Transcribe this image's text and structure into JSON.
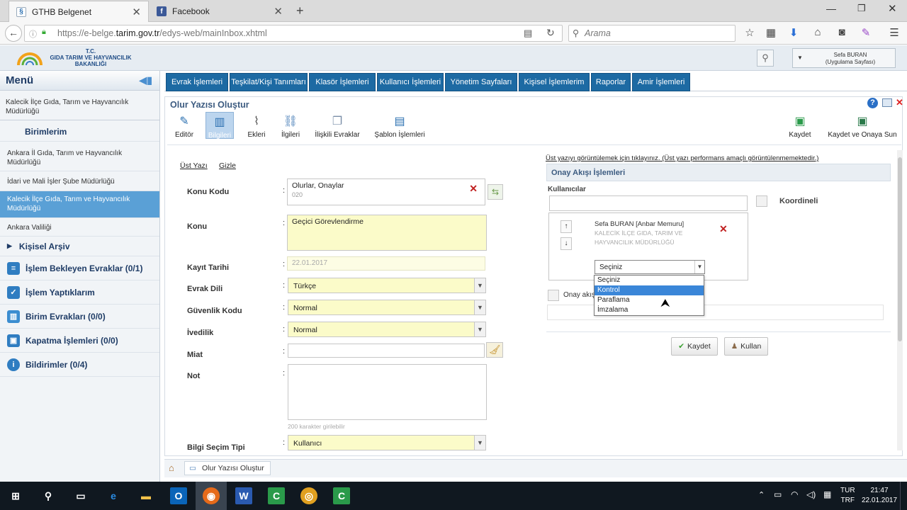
{
  "browser": {
    "tabs": [
      {
        "title": "GTHB Belgenet",
        "active": true
      },
      {
        "title": "Facebook",
        "active": false
      }
    ],
    "url_prefix": "https://e-belge.",
    "url_domain": "tarim.gov.tr",
    "url_suffix": "/edys-web/mainInbox.xhtml",
    "search_placeholder": "Arama"
  },
  "header": {
    "logo_line1": "T.C.",
    "logo_line2": "GIDA TARIM VE HAYVANCILIK",
    "logo_line3": "BAKANLIĞI",
    "user_name": "Sefa BURAN",
    "user_sub": "(Uygulama Sayfası)"
  },
  "sidebar": {
    "title": "Menü",
    "org": "Kalecik İlçe Gıda, Tarım ve Hayvancılık Müdürlüğü",
    "birimlerim": "Birimlerim",
    "units": [
      {
        "label": "Ankara İl Gıda, Tarım ve Hayvancılık Müdürlüğü",
        "selected": false
      },
      {
        "label": "İdari ve Mali İşler Şube Müdürlüğü",
        "selected": false
      },
      {
        "label": "Kalecik İlçe Gıda, Tarım ve Hayvancılık Müdürlüğü",
        "selected": true
      },
      {
        "label": "Ankara Valiliği",
        "selected": false
      }
    ],
    "kisisel_arsiv": "Kişisel Arşiv",
    "items": [
      {
        "label": "İşlem Bekleyen Evraklar (0/1)",
        "icon": "document-wait-icon",
        "color": "#2f7dc1"
      },
      {
        "label": "İşlem Yaptıklarım",
        "icon": "document-done-icon",
        "color": "#2f7dc1"
      },
      {
        "label": "Birim Evrakları (0/0)",
        "icon": "unit-docs-icon",
        "color": "#3b8dd0"
      },
      {
        "label": "Kapatma İşlemleri (0/0)",
        "icon": "close-ops-icon",
        "color": "#2f7dc1"
      },
      {
        "label": "Bildirimler (0/4)",
        "icon": "info-icon",
        "color": "#2f7dc1"
      }
    ]
  },
  "topmenu": [
    "Evrak İşlemleri",
    "Teşkilat/Kişi Tanımları",
    "Klasör İşlemleri",
    "Kullanıcı İşlemleri",
    "Yönetim Sayfaları",
    "Kişisel İşlemlerim",
    "Raporlar",
    "Amir İşlemleri"
  ],
  "form": {
    "title": "Olur Yazısı Oluştur",
    "toolbar": [
      "Editör",
      "Bilgileri",
      "Ekleri",
      "İlgileri",
      "İlişkili Evraklar",
      "Şablon İşlemleri"
    ],
    "save": "Kaydet",
    "save_submit": "Kaydet ve Onaya Sun",
    "ust_yazi": "Üst Yazı",
    "gizle": "Gizle",
    "konu_kodu_label": "Konu Kodu",
    "konu_kodu_value": "Olurlar, Onaylar",
    "konu_kodu_code": "020",
    "konu_label": "Konu",
    "konu_value": "Geçici Görevlendirme",
    "kayit_tarihi_label": "Kayıt Tarihi",
    "kayit_tarihi_value": "22.01.2017",
    "evrak_dili_label": "Evrak Dili",
    "evrak_dili_value": "Türkçe",
    "guvenlik_label": "Güvenlik Kodu",
    "guvenlik_value": "Normal",
    "ivedilik_label": "İvedilik",
    "ivedilik_value": "Normal",
    "miat_label": "Miat",
    "not_label": "Not",
    "not_hint": "200 karakter girilebilir",
    "bilgi_label": "Bilgi Seçim Tipi",
    "bilgi_value": "Kullanıcı",
    "colon": ":"
  },
  "onay": {
    "hint": "Üst yazıyı görüntülemek için tıklayınız. (Üst yazı performans amaçlı görüntülenmemektedir.)",
    "title": "Onay Akışı İşlemleri",
    "kullanicilar": "Kullanıcılar",
    "koordineli": "Koordineli",
    "person_name": "Sefa BURAN [Anbar Memuru]",
    "person_unit": "KALECİK İLÇE GIDA, TARIM VE HAYVANCILIK MÜDÜRLÜĞÜ",
    "select_value": "Seçiniz",
    "options": [
      "Seçiniz",
      "Kontrol",
      "Paraflama",
      "İmzalama"
    ],
    "highlighted_option": 1,
    "onay_akis": "Onay akış",
    "kaydet": "Kaydet",
    "kullan": "Kullan"
  },
  "breadcrumb": "Olur Yazısı Oluştur",
  "taskbar": {
    "lang1": "TUR",
    "lang2": "TRF",
    "time": "21:47",
    "date": "22.01.2017"
  },
  "colors": {
    "nav_blue": "#1d6aa3",
    "selected": "#5aa0d6",
    "field_yellow": "#fbfbc9",
    "highlight": "#3a86d8"
  }
}
